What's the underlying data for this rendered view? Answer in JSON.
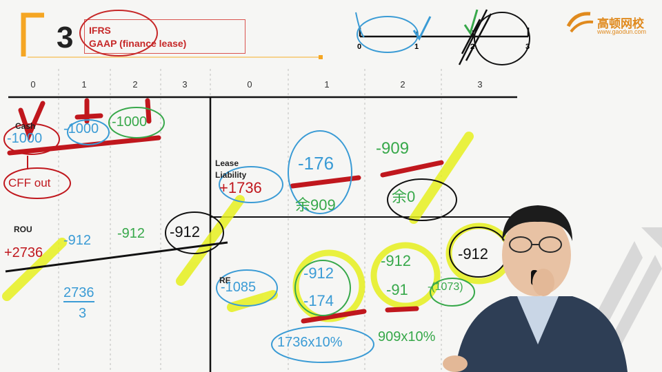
{
  "header": {
    "slide_number": "3",
    "title_lines": [
      "IFRS",
      "GAAP (finance lease)"
    ]
  },
  "logo": {
    "name": "高顿网校",
    "url": "www.gaodun.com"
  },
  "timeline": {
    "ticks": [
      "0",
      "1",
      "2",
      "3"
    ]
  },
  "left_table": {
    "columns": [
      "0",
      "1",
      "2",
      "3"
    ],
    "rows": {
      "cash": {
        "label": "Cash",
        "values": [
          "-1000",
          "-1000",
          "-1000"
        ],
        "note": "CFF out"
      },
      "rou": {
        "label": "ROU",
        "values": [
          "+2736",
          "-912",
          "-912",
          "-912"
        ],
        "calc_top": "2736",
        "calc_bottom": "3"
      }
    }
  },
  "right_table": {
    "columns": [
      "0",
      "1",
      "2",
      "3"
    ],
    "rows": {
      "lease_liability": {
        "label_line1": "Lease",
        "label_line2": "Liability",
        "values": [
          "+1736",
          "-176",
          "-909"
        ],
        "balances": [
          "余909",
          "余0"
        ]
      },
      "re": {
        "label": "RE",
        "values": [
          "-1085",
          "-912",
          "-912",
          "-912"
        ],
        "interest": [
          "-174",
          "-91",
          "-(1073)"
        ],
        "calc": [
          "1736x10%",
          "909x10%"
        ]
      }
    }
  },
  "colors": {
    "red_marker": "#c0171d",
    "blue_pen": "#3a9bd5",
    "green_pen": "#37a84a",
    "highlighter": "#e6f01e",
    "accent_orange": "#f5a623"
  }
}
